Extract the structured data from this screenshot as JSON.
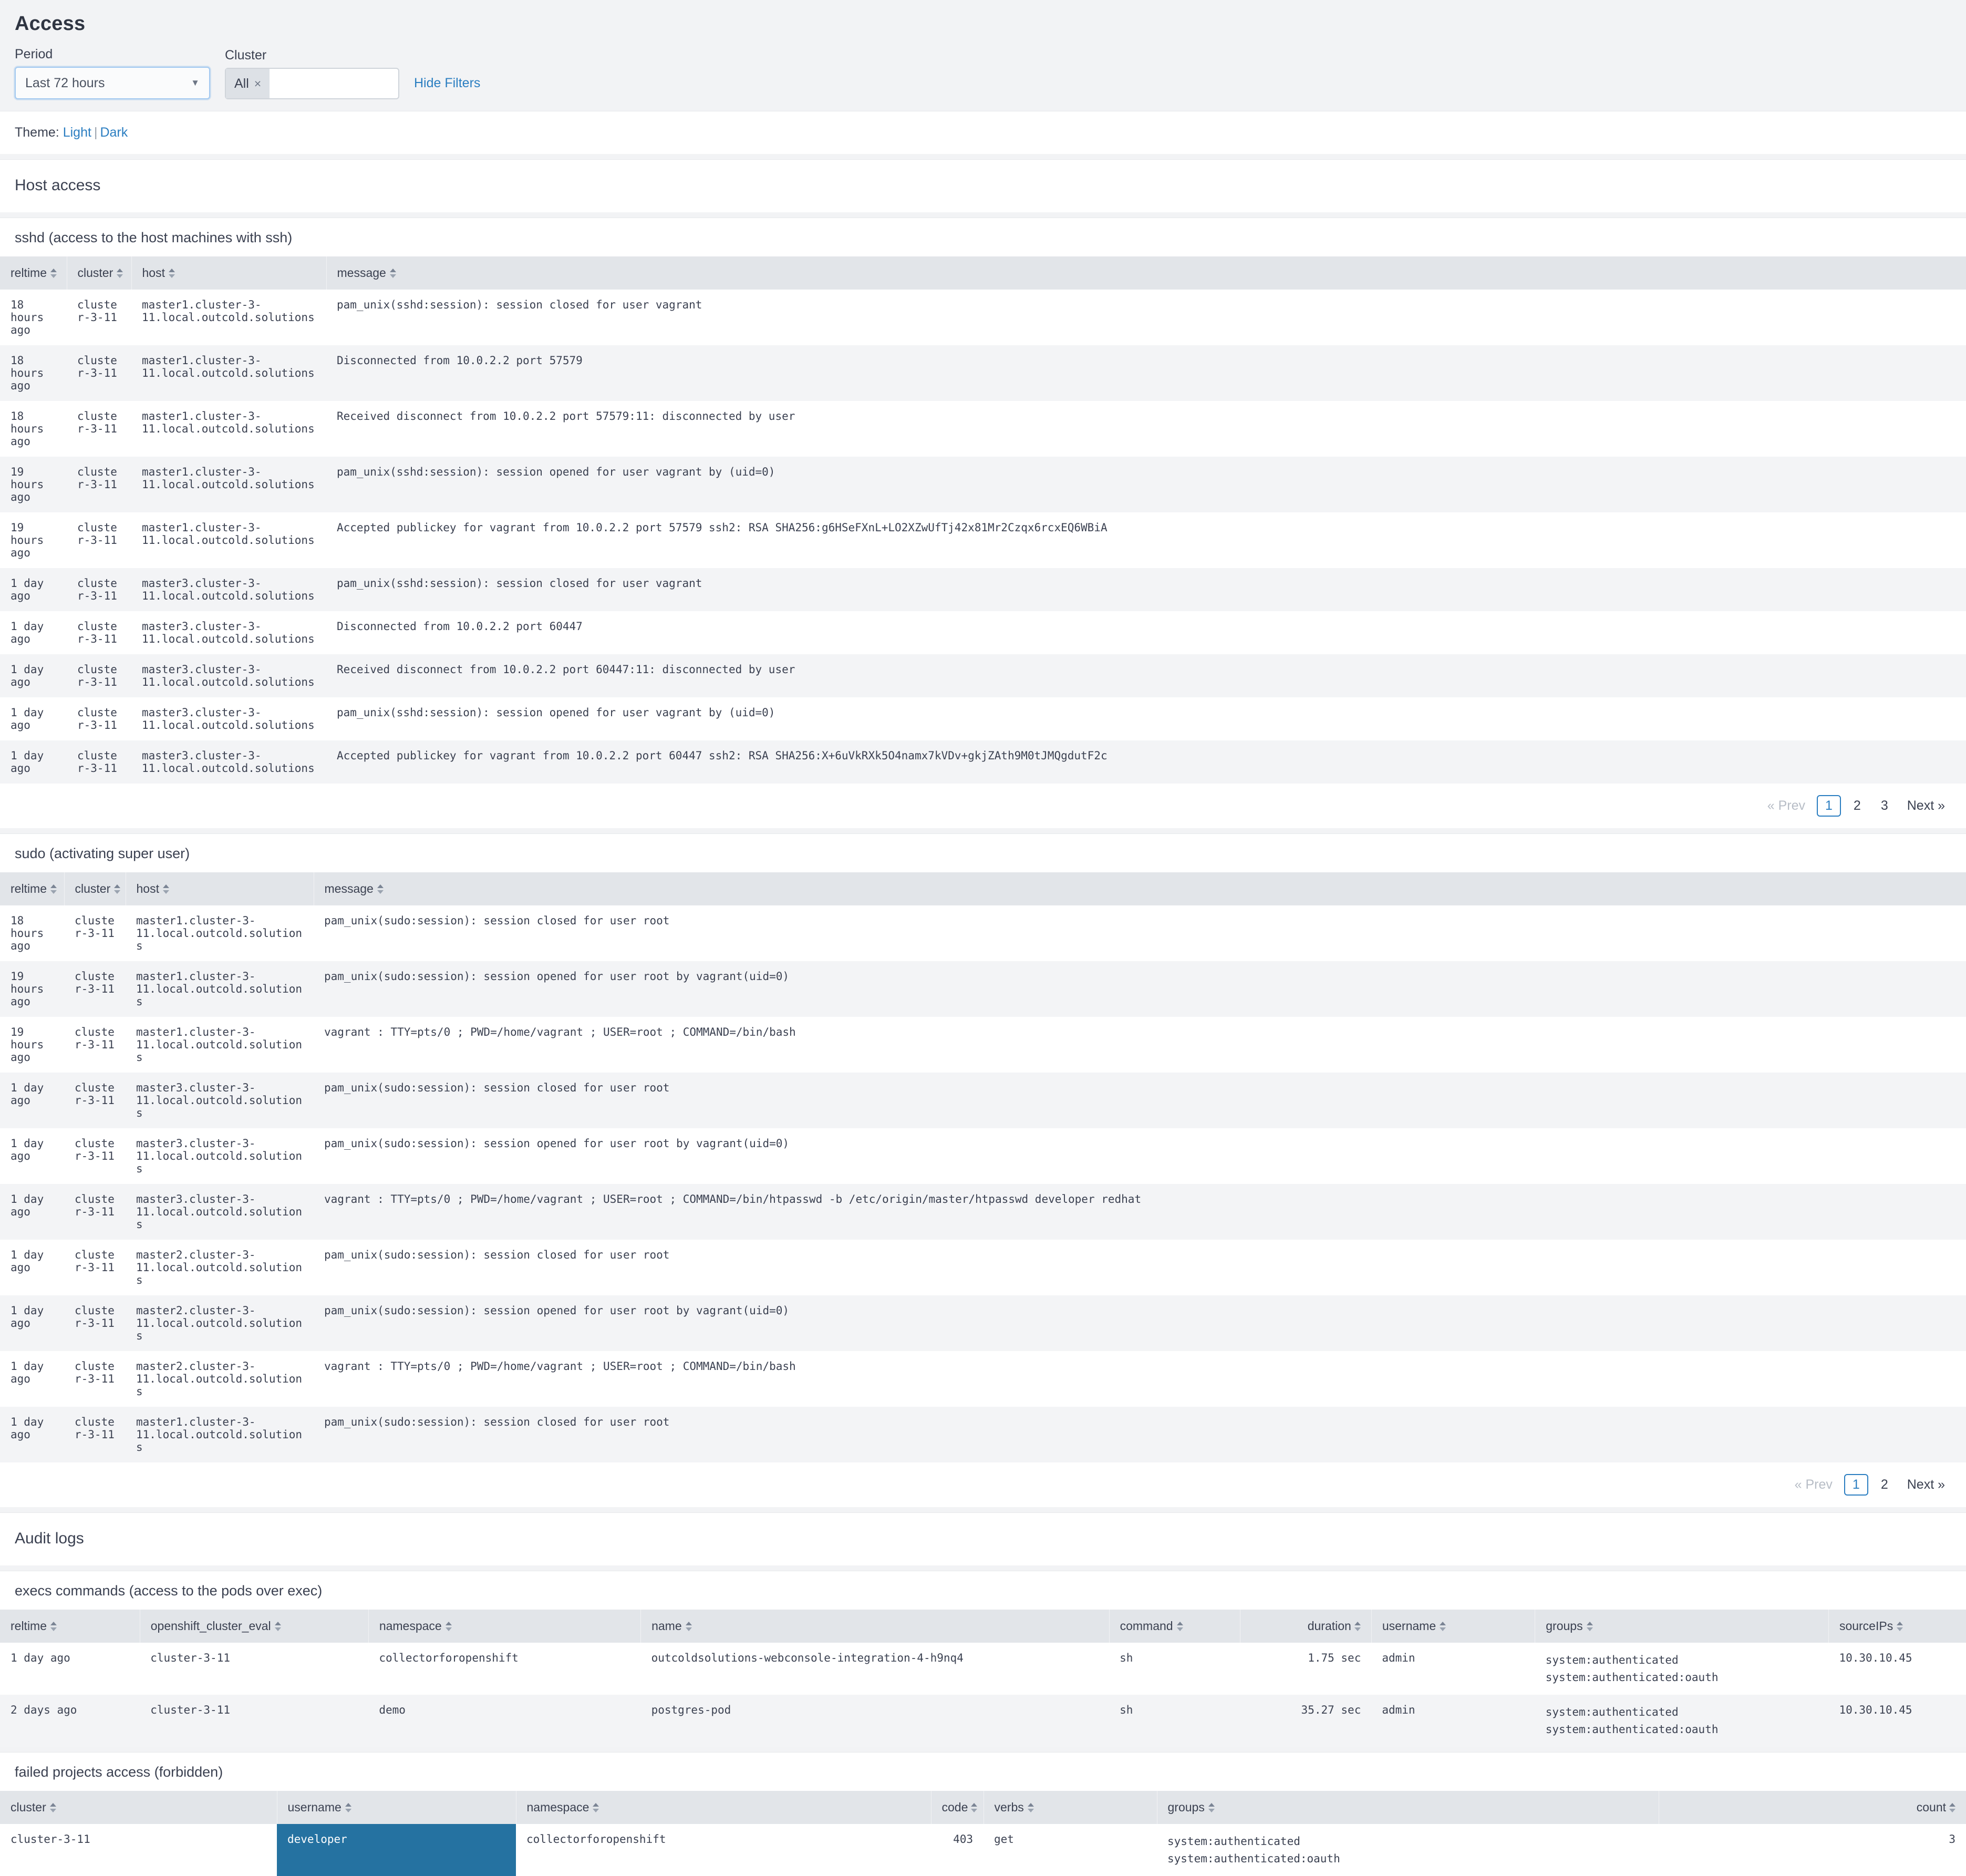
{
  "page": {
    "title": "Access"
  },
  "filters": {
    "period": {
      "label": "Period",
      "value": "Last 72 hours"
    },
    "cluster": {
      "label": "Cluster",
      "token": "All",
      "token_remove": "×",
      "placeholder": ""
    },
    "hide_filters": "Hide Filters"
  },
  "theme": {
    "prefix": "Theme:",
    "light": "Light",
    "separator": "|",
    "dark": "Dark"
  },
  "sections": {
    "host_access": "Host access",
    "audit_logs": "Audit logs"
  },
  "sshd": {
    "title": "sshd (access to the host machines with ssh)",
    "columns": [
      "reltime",
      "cluster",
      "host",
      "message"
    ],
    "rows": [
      [
        "18 hours ago",
        "cluster-3-11",
        "master1.cluster-3-11.local.outcold.solutions",
        "pam_unix(sshd:session): session closed for user vagrant"
      ],
      [
        "18 hours ago",
        "cluster-3-11",
        "master1.cluster-3-11.local.outcold.solutions",
        "Disconnected from 10.0.2.2 port 57579"
      ],
      [
        "18 hours ago",
        "cluster-3-11",
        "master1.cluster-3-11.local.outcold.solutions",
        "Received disconnect from 10.0.2.2 port 57579:11: disconnected by user"
      ],
      [
        "19 hours ago",
        "cluster-3-11",
        "master1.cluster-3-11.local.outcold.solutions",
        "pam_unix(sshd:session): session opened for user vagrant by (uid=0)"
      ],
      [
        "19 hours ago",
        "cluster-3-11",
        "master1.cluster-3-11.local.outcold.solutions",
        "Accepted publickey for vagrant from 10.0.2.2 port 57579 ssh2: RSA SHA256:g6HSeFXnL+LO2XZwUfTj42x81Mr2Czqx6rcxEQ6WBiA"
      ],
      [
        "1 day ago",
        "cluster-3-11",
        "master3.cluster-3-11.local.outcold.solutions",
        "pam_unix(sshd:session): session closed for user vagrant"
      ],
      [
        "1 day ago",
        "cluster-3-11",
        "master3.cluster-3-11.local.outcold.solutions",
        "Disconnected from 10.0.2.2 port 60447"
      ],
      [
        "1 day ago",
        "cluster-3-11",
        "master3.cluster-3-11.local.outcold.solutions",
        "Received disconnect from 10.0.2.2 port 60447:11: disconnected by user"
      ],
      [
        "1 day ago",
        "cluster-3-11",
        "master3.cluster-3-11.local.outcold.solutions",
        "pam_unix(sshd:session): session opened for user vagrant by (uid=0)"
      ],
      [
        "1 day ago",
        "cluster-3-11",
        "master3.cluster-3-11.local.outcold.solutions",
        "Accepted publickey for vagrant from 10.0.2.2 port 60447 ssh2: RSA SHA256:X+6uVkRXk5O4namx7kVDv+gkjZAth9M0tJMQgdutF2c"
      ]
    ],
    "pager": {
      "prev": "« Prev",
      "pages": [
        "1",
        "2",
        "3"
      ],
      "active": "1",
      "next": "Next »"
    }
  },
  "sudo": {
    "title": "sudo (activating super user)",
    "columns": [
      "reltime",
      "cluster",
      "host",
      "message"
    ],
    "rows": [
      [
        "18 hours ago",
        "cluster-3-11",
        "master1.cluster-3-11.local.outcold.solutions",
        "pam_unix(sudo:session): session closed for user root"
      ],
      [
        "19 hours ago",
        "cluster-3-11",
        "master1.cluster-3-11.local.outcold.solutions",
        "pam_unix(sudo:session): session opened for user root by vagrant(uid=0)"
      ],
      [
        "19 hours ago",
        "cluster-3-11",
        "master1.cluster-3-11.local.outcold.solutions",
        "vagrant : TTY=pts/0 ; PWD=/home/vagrant ; USER=root ; COMMAND=/bin/bash"
      ],
      [
        "1 day ago",
        "cluster-3-11",
        "master3.cluster-3-11.local.outcold.solutions",
        "pam_unix(sudo:session): session closed for user root"
      ],
      [
        "1 day ago",
        "cluster-3-11",
        "master3.cluster-3-11.local.outcold.solutions",
        "pam_unix(sudo:session): session opened for user root by vagrant(uid=0)"
      ],
      [
        "1 day ago",
        "cluster-3-11",
        "master3.cluster-3-11.local.outcold.solutions",
        "vagrant : TTY=pts/0 ; PWD=/home/vagrant ; USER=root ; COMMAND=/bin/htpasswd -b /etc/origin/master/htpasswd developer redhat"
      ],
      [
        "1 day ago",
        "cluster-3-11",
        "master2.cluster-3-11.local.outcold.solutions",
        "pam_unix(sudo:session): session closed for user root"
      ],
      [
        "1 day ago",
        "cluster-3-11",
        "master2.cluster-3-11.local.outcold.solutions",
        "pam_unix(sudo:session): session opened for user root by vagrant(uid=0)"
      ],
      [
        "1 day ago",
        "cluster-3-11",
        "master2.cluster-3-11.local.outcold.solutions",
        "vagrant : TTY=pts/0 ; PWD=/home/vagrant ; USER=root ; COMMAND=/bin/bash"
      ],
      [
        "1 day ago",
        "cluster-3-11",
        "master1.cluster-3-11.local.outcold.solutions",
        "pam_unix(sudo:session): session closed for user root"
      ]
    ],
    "pager": {
      "prev": "« Prev",
      "pages": [
        "1",
        "2"
      ],
      "active": "1",
      "next": "Next »"
    }
  },
  "execs": {
    "title": "execs commands (access to the pods over exec)",
    "columns": [
      "reltime",
      "openshift_cluster_eval",
      "namespace",
      "name",
      "command",
      "duration",
      "username",
      "groups",
      "sourceIPs"
    ],
    "rows": [
      {
        "reltime": "1 day ago",
        "openshift_cluster_eval": "cluster-3-11",
        "namespace": "collectorforopenshift",
        "name": "outcoldsolutions-webconsole-integration-4-h9nq4",
        "command": "sh",
        "duration": "1.75 sec",
        "username": "admin",
        "groups": [
          "system:authenticated",
          "system:authenticated:oauth"
        ],
        "sourceIPs": "10.30.10.45"
      },
      {
        "reltime": "2 days ago",
        "openshift_cluster_eval": "cluster-3-11",
        "namespace": "demo",
        "name": "postgres-pod",
        "command": "sh",
        "duration": "35.27 sec",
        "username": "admin",
        "groups": [
          "system:authenticated",
          "system:authenticated:oauth"
        ],
        "sourceIPs": "10.30.10.45"
      }
    ]
  },
  "failed_projects": {
    "title": "failed projects access (forbidden)",
    "columns": [
      "cluster",
      "username",
      "namespace",
      "code",
      "verbs",
      "groups",
      "count"
    ],
    "rows": [
      {
        "cluster": "cluster-3-11",
        "username": "developer",
        "namespace": "collectorforopenshift",
        "code": "403",
        "verbs": "get",
        "groups": [
          "system:authenticated",
          "system:authenticated:oauth"
        ],
        "count": "3",
        "username_highlight": "#2572a1"
      }
    ]
  }
}
